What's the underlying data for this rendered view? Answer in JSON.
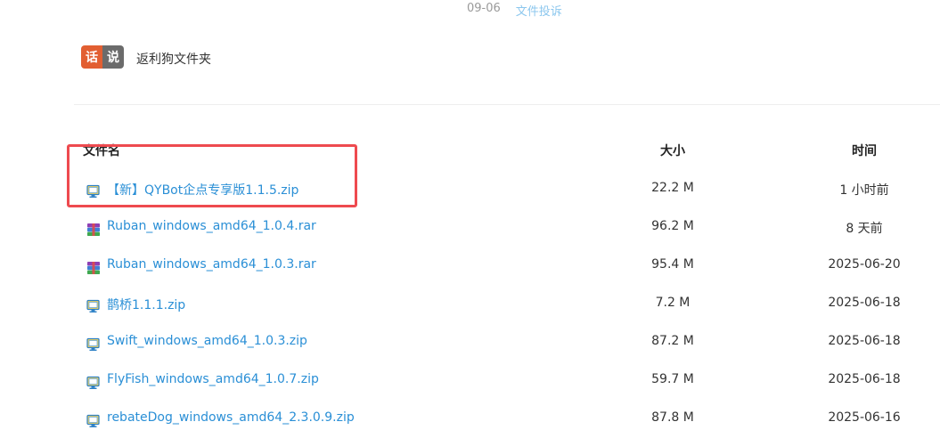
{
  "meta": {
    "date": "09-06",
    "report_link": "文件投诉"
  },
  "brand": {
    "hua": "话",
    "shuo": "说"
  },
  "folder": {
    "name": "返利狗文件夹"
  },
  "table": {
    "headers": {
      "name": "文件名",
      "size": "大小",
      "time": "时间"
    },
    "rows": [
      {
        "name": "【新】QYBot企点专享版1.1.5.zip",
        "size": "22.2 M",
        "time": "1 小时前",
        "icon": "zip-icon"
      },
      {
        "name": "Ruban_windows_amd64_1.0.4.rar",
        "size": "96.2 M",
        "time": "8 天前",
        "icon": "rar-icon"
      },
      {
        "name": "Ruban_windows_amd64_1.0.3.rar",
        "size": "95.4 M",
        "time": "2025-06-20",
        "icon": "rar-icon"
      },
      {
        "name": "鹊桥1.1.1.zip",
        "size": "7.2 M",
        "time": "2025-06-18",
        "icon": "zip-icon"
      },
      {
        "name": "Swift_windows_amd64_1.0.3.zip",
        "size": "87.2 M",
        "time": "2025-06-18",
        "icon": "zip-icon"
      },
      {
        "name": "FlyFish_windows_amd64_1.0.7.zip",
        "size": "59.7 M",
        "time": "2025-06-18",
        "icon": "zip-icon"
      },
      {
        "name": "rebateDog_windows_amd64_2.3.0.9.zip",
        "size": "87.8 M",
        "time": "2025-06-16",
        "icon": "zip-icon"
      }
    ]
  },
  "colors": {
    "link": "#2a8fd6",
    "highlight_border": "#ee4a4f",
    "hua_bg": "#e25f32",
    "shuo_bg": "#6b6b6b"
  }
}
